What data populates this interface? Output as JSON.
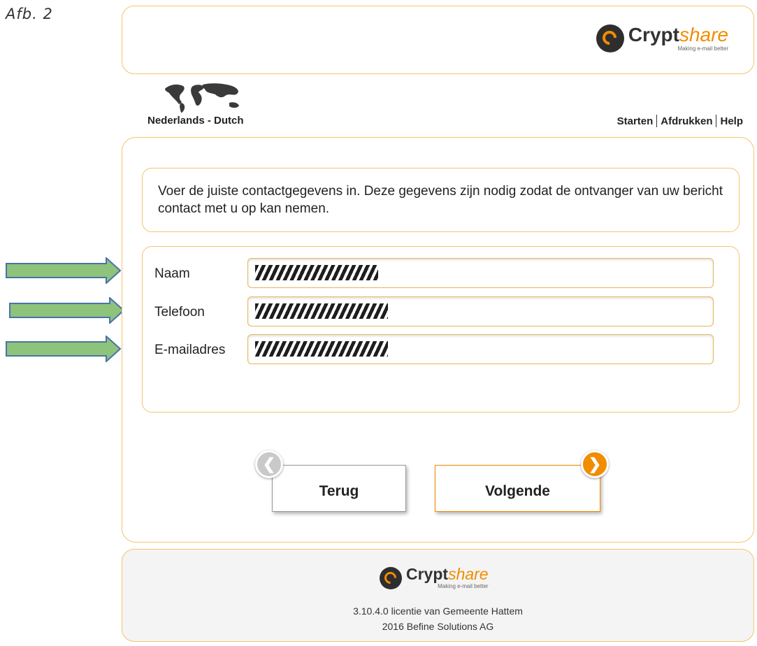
{
  "caption": "Afb. 2",
  "brand": {
    "name_bold": "Crypt",
    "name_light": "share",
    "tagline": "Making e-mail better",
    "accent": "#f28c00",
    "dark": "#2e2e2e"
  },
  "language": {
    "label": "Nederlands - Dutch",
    "icon": "world-map-icon"
  },
  "toplinks": [
    "Starten",
    "Afdrukken",
    "Help"
  ],
  "info_text": "Voer de juiste contactgegevens in. Deze gegevens zijn nodig zodat de ontvanger van uw bericht contact met u op kan nemen.",
  "form": {
    "fields": [
      {
        "label": "Naam",
        "value_redacted": true
      },
      {
        "label": "Telefoon",
        "value_redacted": true
      },
      {
        "label": "E-mailadres",
        "value_redacted": true
      }
    ]
  },
  "buttons": {
    "back": "Terug",
    "next": "Volgende",
    "back_icon": "chevron-left-icon",
    "next_icon": "chevron-right-icon"
  },
  "footer": {
    "line1": "3.10.4.0 licentie van Gemeente Hattem",
    "line2": "2016 Befine Solutions AG"
  },
  "annotation_arrows": {
    "count": 3,
    "color": "#8dc37a"
  }
}
